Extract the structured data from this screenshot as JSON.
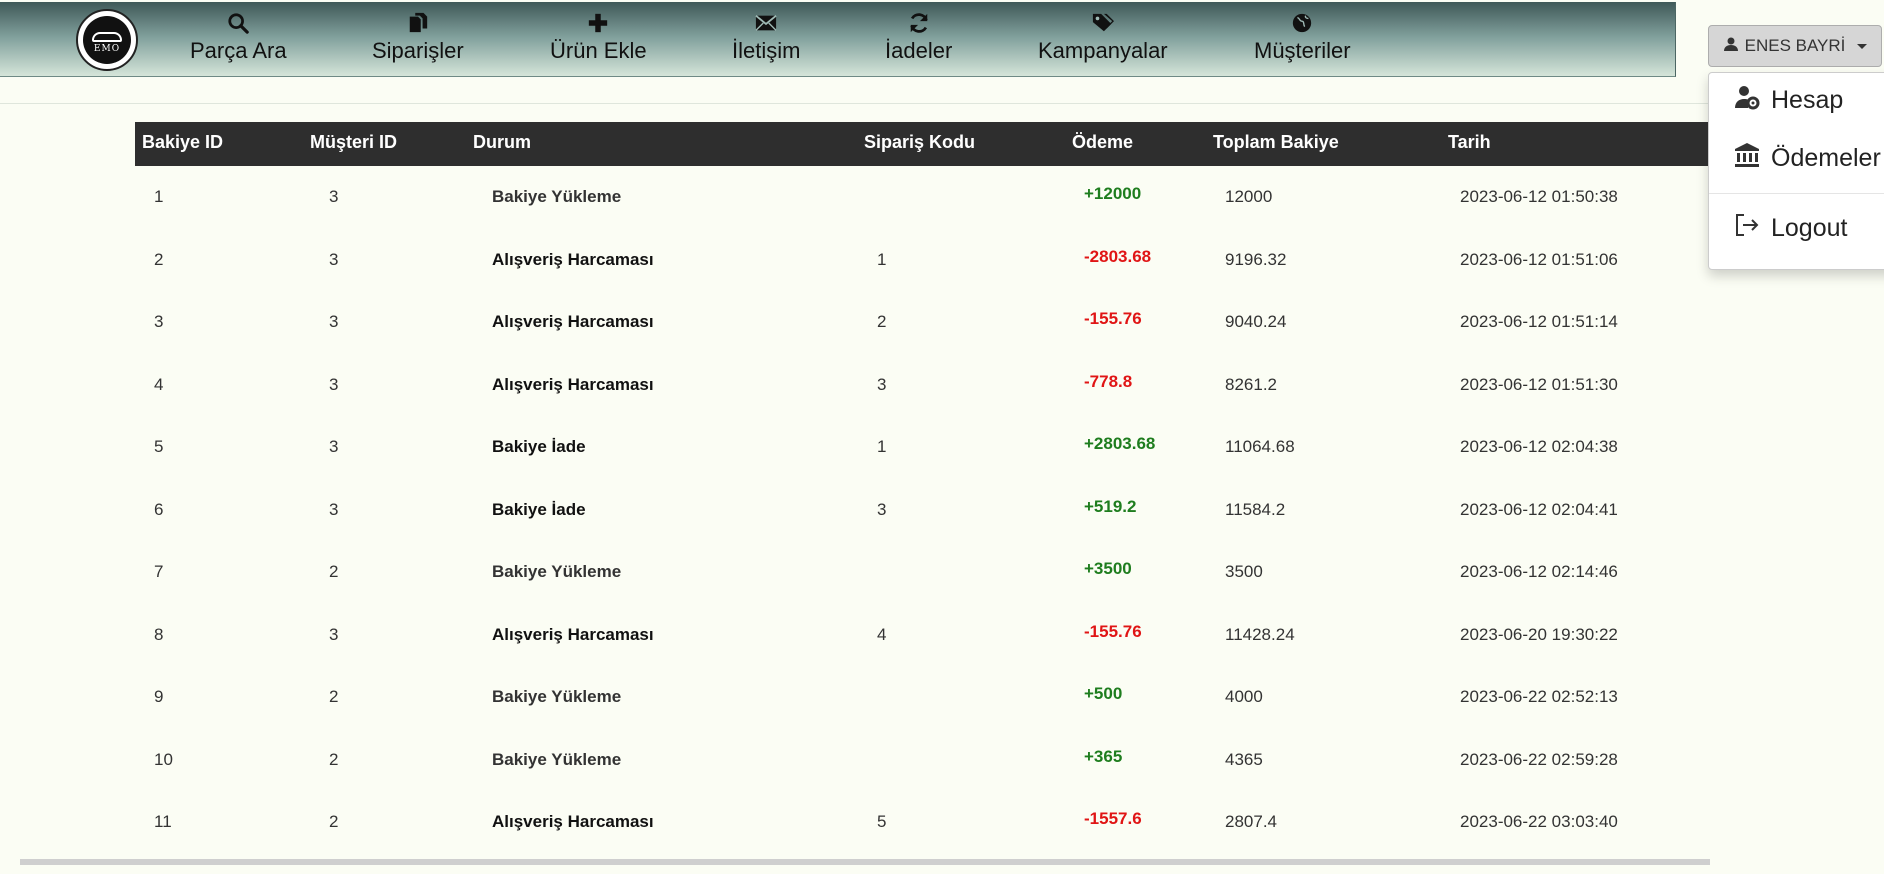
{
  "navbar": {
    "logo_text": "EMO",
    "items": [
      {
        "label": "Parça Ara",
        "icon": "search-icon"
      },
      {
        "label": "Siparişler",
        "icon": "documents-icon"
      },
      {
        "label": "Ürün Ekle",
        "icon": "plus-icon"
      },
      {
        "label": "İletişim",
        "icon": "envelope-icon"
      },
      {
        "label": "İadeler",
        "icon": "refresh-icon"
      },
      {
        "label": "Kampanyalar",
        "icon": "tags-icon"
      },
      {
        "label": "Müşteriler",
        "icon": "globe-icon"
      }
    ]
  },
  "user_menu": {
    "username": "ENES BAYRİ",
    "items": [
      {
        "label": "Hesap",
        "icon": "user-gear-icon"
      },
      {
        "label": "Ödemeler",
        "icon": "bank-icon"
      },
      {
        "label": "Logout",
        "icon": "logout-icon"
      }
    ]
  },
  "table": {
    "columns": [
      "Bakiye ID",
      "Müşteri ID",
      "Durum",
      "Sipariş Kodu",
      "Ödeme",
      "Toplam Bakiye",
      "Tarih"
    ],
    "rows": [
      {
        "id": "1",
        "customer": "3",
        "status": "Bakiye Yükleme",
        "kind": "load",
        "order": "",
        "payment": "+12000",
        "total": "12000",
        "date": "2023-06-12 01:50:38"
      },
      {
        "id": "2",
        "customer": "3",
        "status": "Alışveriş Harcaması",
        "kind": "spend",
        "order": "1",
        "payment": "-2803.68",
        "total": "9196.32",
        "date": "2023-06-12 01:51:06"
      },
      {
        "id": "3",
        "customer": "3",
        "status": "Alışveriş Harcaması",
        "kind": "spend",
        "order": "2",
        "payment": "-155.76",
        "total": "9040.24",
        "date": "2023-06-12 01:51:14"
      },
      {
        "id": "4",
        "customer": "3",
        "status": "Alışveriş Harcaması",
        "kind": "spend",
        "order": "3",
        "payment": "-778.8",
        "total": "8261.2",
        "date": "2023-06-12 01:51:30"
      },
      {
        "id": "5",
        "customer": "3",
        "status": "Bakiye İade",
        "kind": "refund",
        "order": "1",
        "payment": "+2803.68",
        "total": "11064.68",
        "date": "2023-06-12 02:04:38"
      },
      {
        "id": "6",
        "customer": "3",
        "status": "Bakiye İade",
        "kind": "refund",
        "order": "3",
        "payment": "+519.2",
        "total": "11584.2",
        "date": "2023-06-12 02:04:41"
      },
      {
        "id": "7",
        "customer": "2",
        "status": "Bakiye Yükleme",
        "kind": "load",
        "order": "",
        "payment": "+3500",
        "total": "3500",
        "date": "2023-06-12 02:14:46"
      },
      {
        "id": "8",
        "customer": "3",
        "status": "Alışveriş Harcaması",
        "kind": "spend",
        "order": "4",
        "payment": "-155.76",
        "total": "11428.24",
        "date": "2023-06-20 19:30:22"
      },
      {
        "id": "9",
        "customer": "2",
        "status": "Bakiye Yükleme",
        "kind": "load",
        "order": "",
        "payment": "+500",
        "total": "4000",
        "date": "2023-06-22 02:52:13"
      },
      {
        "id": "10",
        "customer": "2",
        "status": "Bakiye Yükleme",
        "kind": "load",
        "order": "",
        "payment": "+365",
        "total": "4365",
        "date": "2023-06-22 02:59:28"
      },
      {
        "id": "11",
        "customer": "2",
        "status": "Alışveriş Harcaması",
        "kind": "spend",
        "order": "5",
        "payment": "-1557.6",
        "total": "2807.4",
        "date": "2023-06-22 03:03:40"
      }
    ]
  },
  "colors": {
    "positive": "#1e7d1e",
    "negative": "#e01515",
    "header_bg": "#2e2e2e",
    "page_bg": "#fbfdf4"
  }
}
